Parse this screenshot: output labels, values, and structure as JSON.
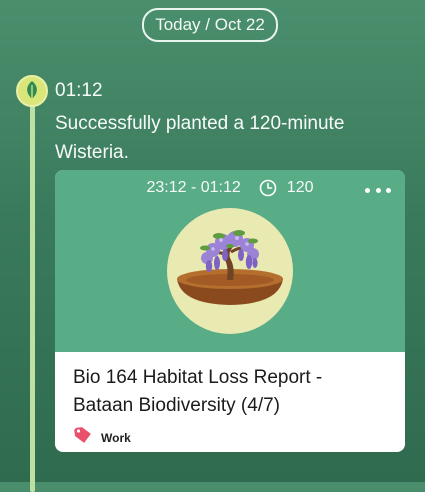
{
  "header": {
    "date_label": "Today / Oct 22"
  },
  "entry": {
    "time": "01:12",
    "message": "Successfully planted a 120-minute Wisteria.",
    "icon": "leaf-icon"
  },
  "card": {
    "time_range": "23:12 - 01:12",
    "duration": "120",
    "clock_icon": "clock-icon",
    "more_icon": "more-icon",
    "tree_name": "Wisteria",
    "task_title": "Bio 164 Habitat Loss Report - Bataan Biodiversity (4/7)",
    "tag": {
      "label": "Work",
      "icon": "tag-icon",
      "color": "#e9506b"
    }
  },
  "colors": {
    "background": "#3a7a5c",
    "card_top": "#58ac86",
    "timeline": "#bfe0a3",
    "leaf_dot": "#d9e67a"
  }
}
